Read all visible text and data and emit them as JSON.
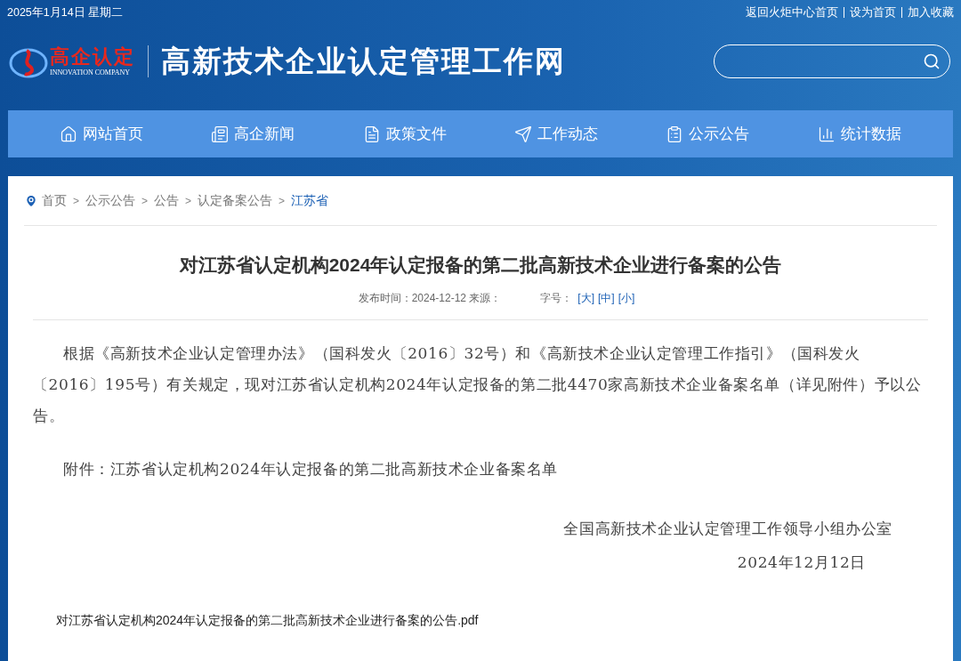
{
  "top_bar": {
    "date": "2025年1月14日 星期二",
    "links": [
      "返回火炬中心首页",
      "设为首页",
      "加入收藏"
    ]
  },
  "header": {
    "logo_text": "高企认定",
    "logo_subtext": "INNOVATION COMPANY",
    "site_title": "高新技术企业认定管理工作网"
  },
  "nav": [
    {
      "label": "网站首页",
      "kind": "home"
    },
    {
      "label": "高企新闻",
      "kind": "news"
    },
    {
      "label": "政策文件",
      "kind": "file"
    },
    {
      "label": "工作动态",
      "kind": "send"
    },
    {
      "label": "公示公告",
      "kind": "notice"
    },
    {
      "label": "统计数据",
      "kind": "chart"
    }
  ],
  "breadcrumb_separator": ">",
  "breadcrumb": [
    {
      "label": "首页",
      "selected": false
    },
    {
      "label": "公示公告",
      "selected": false
    },
    {
      "label": "公告",
      "selected": false
    },
    {
      "label": "认定备案公告",
      "selected": false
    },
    {
      "label": "江苏省",
      "selected": true
    }
  ],
  "article": {
    "title": "对江苏省认定机构2024年认定报备的第二批高新技术企业进行备案的公告",
    "meta": "发布时间：2024-12-12 来源：",
    "font_size_label": "字号：",
    "font_sizes": [
      "[大]",
      "[中]",
      "[小]"
    ],
    "body": "根据《高新技术企业认定管理办法》（国科发火〔2016〕32号）和《高新技术企业认定管理工作指引》（国科发火〔2016〕195号）有关规定，现对江苏省认定机构2024年认定报备的第二批4470家高新技术企业备案名单（详见附件）予以公告。",
    "attachment": "附件：江苏省认定机构2024年认定报备的第二批高新技术企业备案名单",
    "signature": "全国高新技术企业认定管理工作领导小组办公室",
    "date": "2024年12月12日",
    "file_link": "对江苏省认定机构2024年认定报备的第二批高新技术企业进行备案的公告.pdf"
  }
}
